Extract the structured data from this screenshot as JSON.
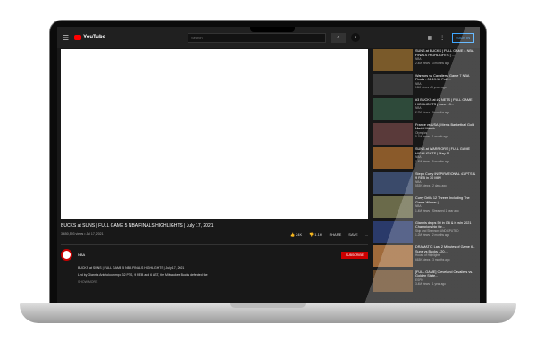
{
  "header": {
    "logo": "YouTube",
    "search_placeholder": "Search",
    "sign_in": "SIGN IN"
  },
  "video": {
    "title": "BUCKS at SUNS | FULL GAME 5 NBA FINALS HIGHLIGHTS | July 17, 2021",
    "views": "3,650,593 views • Jul 17, 2021",
    "likes": "24K",
    "dislikes": "1.1K",
    "share": "SHARE",
    "save": "SAVE",
    "more": "..."
  },
  "channel": {
    "name": "NBA",
    "subscribe": "SUBSCRIBE",
    "desc1": "BUCKS at SUNS | FULL GAME 5 NBA FINALS HIGHLIGHTS | July 17, 2021",
    "desc2": "Led by Giannis Antetokounmpo 32 PTS, 9 REB and 6 AST, the Milwaukee Bucks defeated the",
    "show_more": "SHOW MORE"
  },
  "sidebar": [
    {
      "title": "SUNS at BUCKS | FULL GAME 4 NBA FINALS HIGHLIGHTS | ...",
      "channel": "NBA",
      "meta": "2.4M views • 3 months ago",
      "color": "#7a5a2a"
    },
    {
      "title": "Warriors vs Cavaliers: Game 7 NBA Finals - 06.19.16 Full ...",
      "channel": "NBA",
      "meta": "16M views • 5 years ago",
      "color": "#3a3a3a"
    },
    {
      "title": "#3 BUCKS at #2 NETS | FULL GAME HIGHLIGHTS | June 19...",
      "channel": "NBA",
      "meta": "2.7M views • 3 months ago",
      "color": "#2e4a3a"
    },
    {
      "title": "France vs USA | Men's Basketball Gold Medal Match...",
      "channel": "Olympics",
      "meta": "5.1M views • 1 month ago",
      "color": "#5a3a3a"
    },
    {
      "title": "SUNS at WARRIORS | FULL GAME HIGHLIGHTS | May 11...",
      "channel": "NBA",
      "meta": "1.4M views • 5 months ago",
      "color": "#8a5a2a"
    },
    {
      "title": "Steph Curry INSPIRATIONAL 41 PTS & 9 REB in 30 MIN!",
      "channel": "NBA",
      "meta": "553K views • 2 days ago",
      "color": "#3a4a6a"
    },
    {
      "title": "Curry Drills 12 Threes Including The Game-Winner | ...",
      "channel": "NBA",
      "meta": "1.4M views • Streamed 1 year ago",
      "color": "#6a6a4a"
    },
    {
      "title": "Giannis drops 50 in G6 & is win 2021 Championship for...",
      "channel": "Skip and Shannon: UNDISPUTED",
      "meta": "1.2M views • 2 months ago",
      "color": "#2a3a6a"
    },
    {
      "title": "DRAMATIC Last 2 Minutes of Game 6 - Suns vs Bucks - 20...",
      "channel": "House of Highlights",
      "meta": "663K views • 3 months ago",
      "color": "#a06a3a"
    },
    {
      "title": "[FULL GAME] Cleveland Cavaliers vs. Golden State...",
      "channel": "ESPN",
      "meta": "3.4M views • 1 year ago",
      "color": "#6a4a2a"
    }
  ]
}
